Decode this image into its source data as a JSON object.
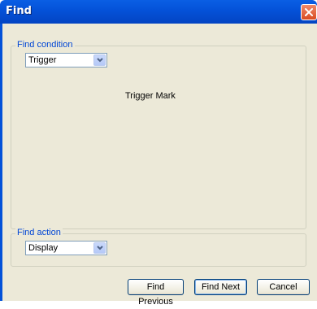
{
  "window": {
    "title": "Find"
  },
  "find_condition": {
    "group_label": "Find condition",
    "selected": "Trigger",
    "detail_text": "Trigger Mark"
  },
  "find_action": {
    "group_label": "Find action",
    "selected": "Display"
  },
  "buttons": {
    "find_previous": "Find Previous",
    "find_next": "Find Next",
    "cancel": "Cancel"
  },
  "icons": {
    "close": "close-icon",
    "dropdown": "chevron-down-icon"
  },
  "colors": {
    "titlebar": "#0451d8",
    "client_background": "#ece9d8",
    "group_label": "#0046d5",
    "close_button": "#d94b21"
  }
}
